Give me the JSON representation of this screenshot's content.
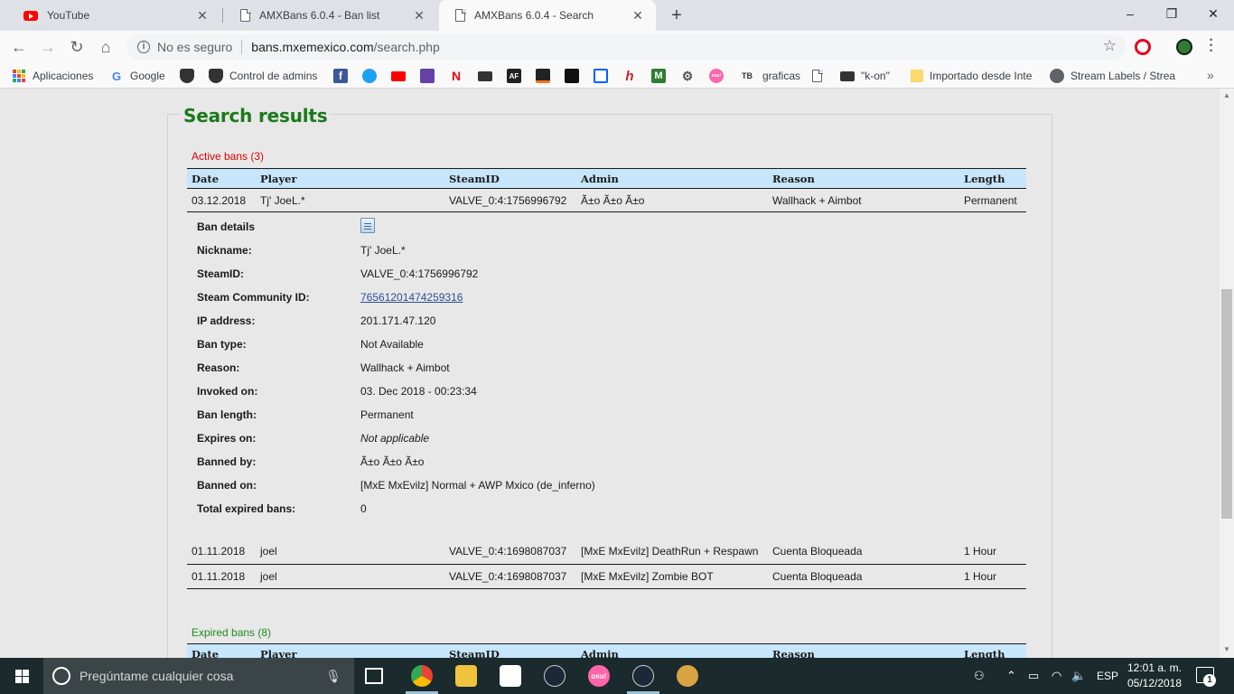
{
  "tabs": [
    {
      "title": "YouTube"
    },
    {
      "title": "AMXBans 6.0.4 - Ban list"
    },
    {
      "title": "AMXBans 6.0.4 - Search"
    }
  ],
  "omnibox": {
    "security": "No es seguro",
    "host": "bans.mxemexico.com",
    "path": "/search.php"
  },
  "bookmarks": {
    "apps": "Aplicaciones",
    "google": "Google",
    "control": "Control de admins",
    "graficas": "graficas",
    "tb": "TB",
    "af": "AF",
    "osu": "osu!",
    "kon": "\"k-on\"",
    "importado": "Importado desde Inte",
    "streamlabels": "Stream Labels / Strea"
  },
  "page": {
    "heading": "Search results",
    "active_title": "Active bans (3)",
    "expired_title": "Expired bans (8)",
    "columns": [
      "Date",
      "Player",
      "SteamID",
      "Admin",
      "Reason",
      "Length"
    ],
    "first_ban": {
      "date": "03.12.2018",
      "player": "Tj' JoeL.*",
      "steamid": "VALVE_0:4:1756996792",
      "admin": "Ã±o Ã±o Ã±o",
      "reason": "Wallhack + Aimbot",
      "length": "Permanent"
    },
    "details": [
      {
        "label": "Ban details",
        "value": ""
      },
      {
        "label": "Nickname:",
        "value": "Tj' JoeL.*"
      },
      {
        "label": "SteamID:",
        "value": "VALVE_0:4:1756996792"
      },
      {
        "label": "Steam Community ID:",
        "value": "76561201474259316"
      },
      {
        "label": "IP address:",
        "value": "201.171.47.120"
      },
      {
        "label": "Ban type:",
        "value": "Not Available"
      },
      {
        "label": "Reason:",
        "value": "Wallhack + Aimbot"
      },
      {
        "label": "Invoked on:",
        "value": "03. Dec 2018 - 00:23:34"
      },
      {
        "label": "Ban length:",
        "value": "Permanent"
      },
      {
        "label": "Expires on:",
        "value": "Not applicable"
      },
      {
        "label": "Banned by:",
        "value": "Ã±o Ã±o Ã±o"
      },
      {
        "label": "Banned on:",
        "value": "[MxE MxEvilz] Normal + AWP Mxico (de_inferno)"
      },
      {
        "label": "Total expired bans:",
        "value": "0"
      }
    ],
    "other_bans": [
      {
        "date": "01.11.2018",
        "player": "joel",
        "steamid": "VALVE_0:4:1698087037",
        "admin": "[MxE MxEvilz] DeathRun + Respawn",
        "reason": "Cuenta Bloqueada",
        "length": "1 Hour"
      },
      {
        "date": "01.11.2018",
        "player": "joel",
        "steamid": "VALVE_0:4:1698087037",
        "admin": "[MxE MxEvilz] Zombie BOT",
        "reason": "Cuenta Bloqueada",
        "length": "1 Hour"
      }
    ]
  },
  "taskbar": {
    "search_placeholder": "Pregúntame cualquier cosa",
    "osu": "osu!",
    "language": "ESP",
    "time": "12:01 a. m.",
    "date": "05/12/2018",
    "notifications": "1"
  },
  "colors": {
    "heading_green": "#1a7a1a",
    "active_red": "#e00000",
    "expired_green": "#1e8c1e",
    "table_header": "#c7e6fb",
    "link": "#2a4f9a"
  }
}
